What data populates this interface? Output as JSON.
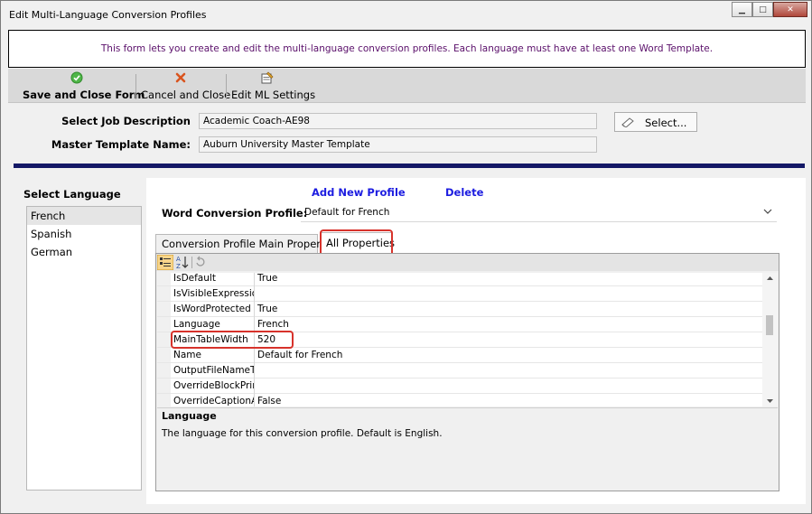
{
  "window": {
    "title": "Edit Multi-Language Conversion Profiles",
    "controls": {
      "minimize": "▁",
      "maximize": "□",
      "close": "✕"
    }
  },
  "info": {
    "text": "This form lets you create and edit the multi-language conversion profiles. Each language must have at least one Word Template."
  },
  "toolbar": {
    "save_label": "Save and Close Form",
    "cancel_label": "Cancel and Close",
    "settings_label": "Edit ML Settings",
    "icons": {
      "save": "check-circle-icon",
      "cancel": "x-icon",
      "settings": "settings-edit-icon"
    }
  },
  "header": {
    "job_label": "Select Job Description",
    "job_value": "Academic Coach-AE98",
    "template_label": "Master Template Name:",
    "template_value": "Auburn University Master Template",
    "select_button": "Select..."
  },
  "languages": {
    "label": "Select Language",
    "items": [
      "French",
      "Spanish",
      "German"
    ],
    "selected": "French"
  },
  "profile": {
    "add_label": "Add New Profile",
    "delete_label": "Delete",
    "word_profile_label": "Word Conversion Profile:",
    "word_profile_value": "Default for French"
  },
  "tabs": [
    {
      "label": "Conversion Profile Main Properties",
      "active": false
    },
    {
      "label": "All Properties",
      "active": true
    }
  ],
  "properties": {
    "rows": [
      {
        "name": "IsDefault",
        "value": "True"
      },
      {
        "name": "IsVisibleExpression",
        "value": ""
      },
      {
        "name": "IsWordProtected",
        "value": "True"
      },
      {
        "name": "Language",
        "value": "French"
      },
      {
        "name": "MainTableWidth",
        "value": "520"
      },
      {
        "name": "Name",
        "value": "Default for French"
      },
      {
        "name": "OutputFileNameTag",
        "value": ""
      },
      {
        "name": "OverrideBlockPrintH",
        "value": ""
      },
      {
        "name": "OverrideCaptionAn",
        "value": "False"
      }
    ],
    "selected": "Language",
    "description_title": "Language",
    "description_text": "The language for this conversion profile.  Default is English."
  },
  "colors": {
    "accent_navy": "#141866",
    "link_blue": "#1c1ce0",
    "highlight_red": "#d7322b",
    "info_text": "#5a0f6a"
  }
}
